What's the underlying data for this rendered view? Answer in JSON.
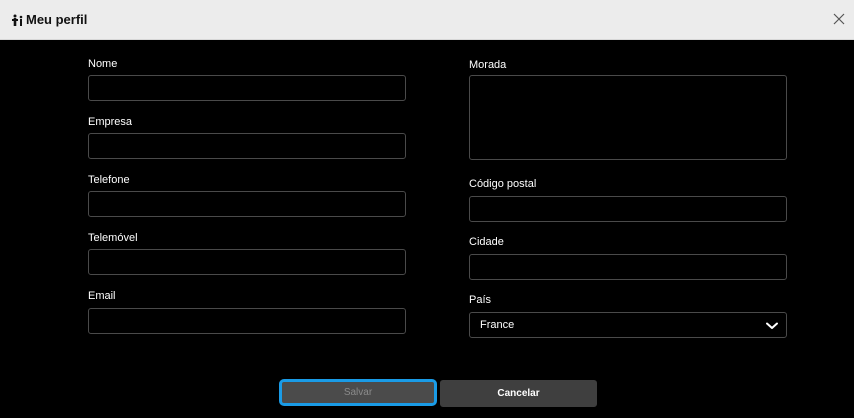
{
  "window": {
    "title": "Meu perfil",
    "title_icon": "people-icon",
    "close_icon": "close-icon"
  },
  "form": {
    "left": [
      {
        "label": "Nome",
        "value": "",
        "placeholder": ""
      },
      {
        "label": "Empresa",
        "value": "",
        "placeholder": ""
      },
      {
        "label": "Telefone",
        "value": "",
        "placeholder": ""
      },
      {
        "label": "Telemóvel",
        "value": "",
        "placeholder": ""
      },
      {
        "label": "Email",
        "value": "",
        "placeholder": ""
      }
    ],
    "right": {
      "morada": {
        "label": "Morada",
        "value": ""
      },
      "codigo_postal": {
        "label": "Código postal",
        "value": ""
      },
      "cidade": {
        "label": "Cidade",
        "value": ""
      },
      "pais": {
        "label": "País",
        "selected": "France",
        "icon": "chevron-down-icon"
      }
    }
  },
  "actions": {
    "save_label": "Salvar",
    "cancel_label": "Cancelar"
  },
  "colors": {
    "focus_ring": "#1a9be6",
    "content_background": "#000000",
    "titlebar_background": "#ececec"
  }
}
